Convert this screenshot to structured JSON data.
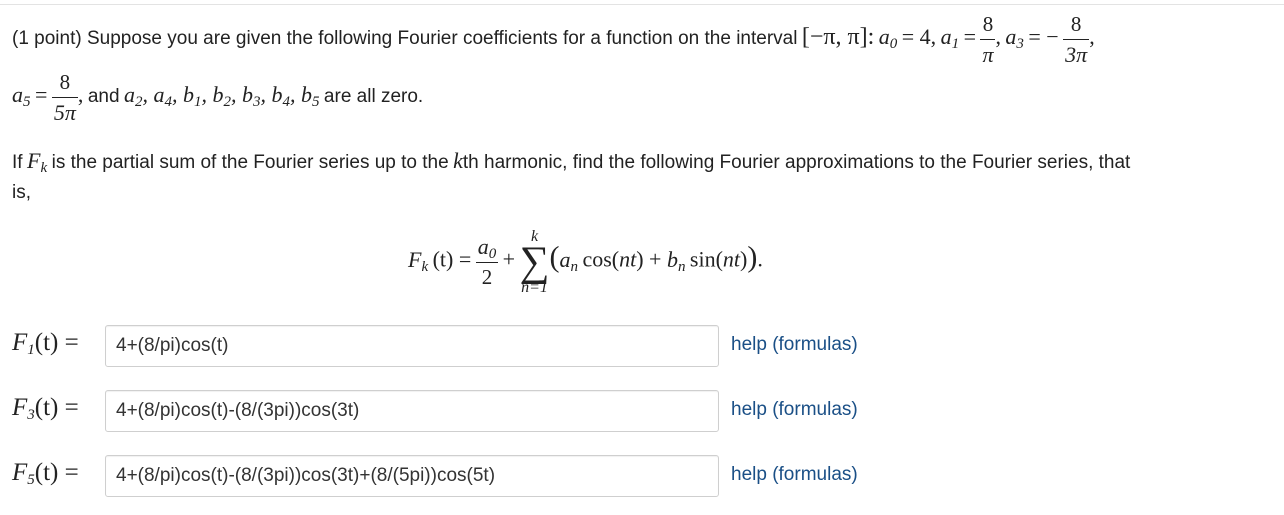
{
  "problem": {
    "line1_prefix": "(1 point) Suppose you are given the following Fourier coefficients for a function on the interval",
    "interval": "[−π, π]:",
    "a0_label": "a",
    "a0_sub": "0",
    "a0_value": "= 4,",
    "a1_label": "a",
    "a1_sub": "1",
    "a1_num": "8",
    "a1_den": "π",
    "a3_label": "a",
    "a3_sub": "3",
    "a3_sign": "= −",
    "a3_num": "8",
    "a3_den": "3π",
    "a5_label": "a",
    "a5_sub": "5",
    "a5_num": "8",
    "a5_den": "5π",
    "line2_suffix": "are all zero.",
    "line3": "If",
    "line3_fk": "F",
    "line3_k": "k",
    "line3_mid": "is the partial sum of the Fourier series up to the",
    "line3_kth": "k",
    "line3_rest": "th harmonic, find the following Fourier approximations to the Fourier series, that",
    "line4": "is,"
  },
  "formula": {
    "lhs": "F",
    "lhs_sub": "k",
    "lhs_arg": "(t) =",
    "a0_num": "a",
    "a0_num_sub": "0",
    "a0_den": "2",
    "plus": "+",
    "sum_top": "k",
    "sum_bottom": "n=1",
    "body": "(a",
    "body_sub_a": "n",
    "cos": "cos(nt) + b",
    "body_sub_b": "n",
    "sin": "sin(nt)).",
    "sigma": "∑"
  },
  "answers": [
    {
      "label": "F",
      "sub": "1",
      "arg": "(t) =",
      "value": "4+(8/pi)cos(t)",
      "help": "help (formulas)"
    },
    {
      "label": "F",
      "sub": "3",
      "arg": "(t) =",
      "value": "4+(8/pi)cos(t)-(8/(3pi))cos(3t)",
      "help": "help (formulas)"
    },
    {
      "label": "F",
      "sub": "5",
      "arg": "(t) =",
      "value": "4+(8/pi)cos(t)-(8/(3pi))cos(3t)+(8/(5pi))cos(5t)",
      "help": "help (formulas)"
    }
  ],
  "colors": {
    "link": "#1a4f86",
    "border": "#cfcfcf"
  }
}
